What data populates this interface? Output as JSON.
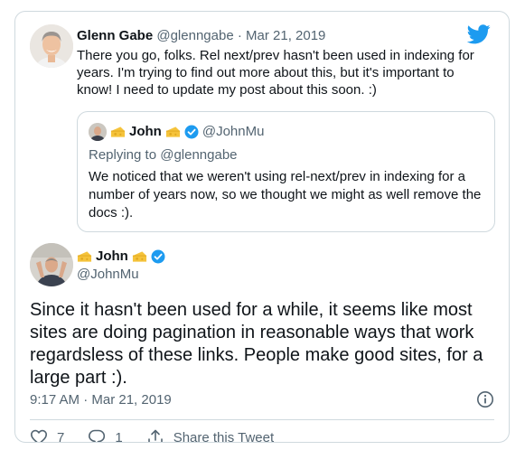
{
  "parent_tweet": {
    "author_name": "Glenn Gabe",
    "author_handle": "@glenngabe",
    "separator": "·",
    "date": "Mar 21, 2019",
    "text": "There you go, folks. Rel next/prev hasn't been used in indexing for years. I'm trying to find out more about this, but it's important to know! I need to update my post about this soon. :)"
  },
  "quoted_tweet": {
    "author_name": "John",
    "author_handle": "@JohnMu",
    "replying_to": "Replying to @glenngabe",
    "text": "We noticed that we weren't using rel-next/prev in indexing for a number of years now, so we thought we might as well remove the docs :)."
  },
  "main_tweet": {
    "author_name": "John",
    "author_handle": "@JohnMu",
    "text": "Since it hasn't been used for a while, it seems like most sites are doing pagination in reasonable ways that work regardsless of these links. People make good sites, for a large part :).",
    "timestamp": "9:17 AM · Mar 21, 2019"
  },
  "actions": {
    "likes": "7",
    "replies": "1",
    "share_label": "Share this Tweet"
  },
  "icons": {
    "brand": "twitter-bird-icon",
    "verified": "verified-badge-icon",
    "emoji": "cheese-icon",
    "info": "info-icon",
    "like": "heart-icon",
    "reply": "reply-icon",
    "share": "share-icon"
  },
  "colors": {
    "brand_blue": "#1d9bf0",
    "muted": "#536471",
    "border": "#cfd9de",
    "cheese": "#f5c33b"
  }
}
